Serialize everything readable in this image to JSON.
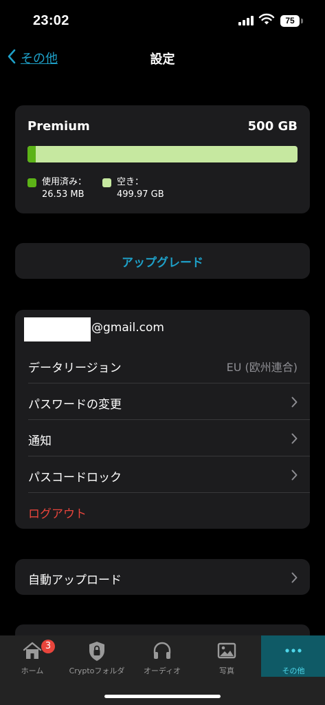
{
  "status_bar": {
    "time": "23:02",
    "battery": "75"
  },
  "nav": {
    "back_label": "その他",
    "title": "設定"
  },
  "storage": {
    "plan": "Premium",
    "total": "500 GB",
    "used_fraction": 5e-05,
    "used_label": "使用済み：",
    "used_value": "26.53 MB",
    "free_label": "空き：",
    "free_value": "499.97 GB",
    "used_color": "#5cb317",
    "free_color": "#c6e8a0"
  },
  "upgrade": {
    "label": "アップグレード"
  },
  "account": {
    "email_suffix": "@gmail.com",
    "data_region_label": "データリージョン",
    "data_region_value": "EU (欧州連合)",
    "change_password_label": "パスワードの変更",
    "notifications_label": "通知",
    "passcode_lock_label": "パスコードロック",
    "logout_label": "ログアウト"
  },
  "auto_upload": {
    "label": "自動アップロード"
  },
  "tab_bar": {
    "home": {
      "label": "ホーム",
      "badge": "3"
    },
    "crypto": {
      "label": "Cryptoフォルダ"
    },
    "audio": {
      "label": "オーディオ"
    },
    "photos": {
      "label": "写真"
    },
    "more": {
      "label": "その他"
    }
  },
  "colors": {
    "accent": "#1ea0c8",
    "danger": "#e8453c",
    "active_tab_bg": "#0f5a66",
    "active_tab_fg": "#4ed6ea"
  }
}
